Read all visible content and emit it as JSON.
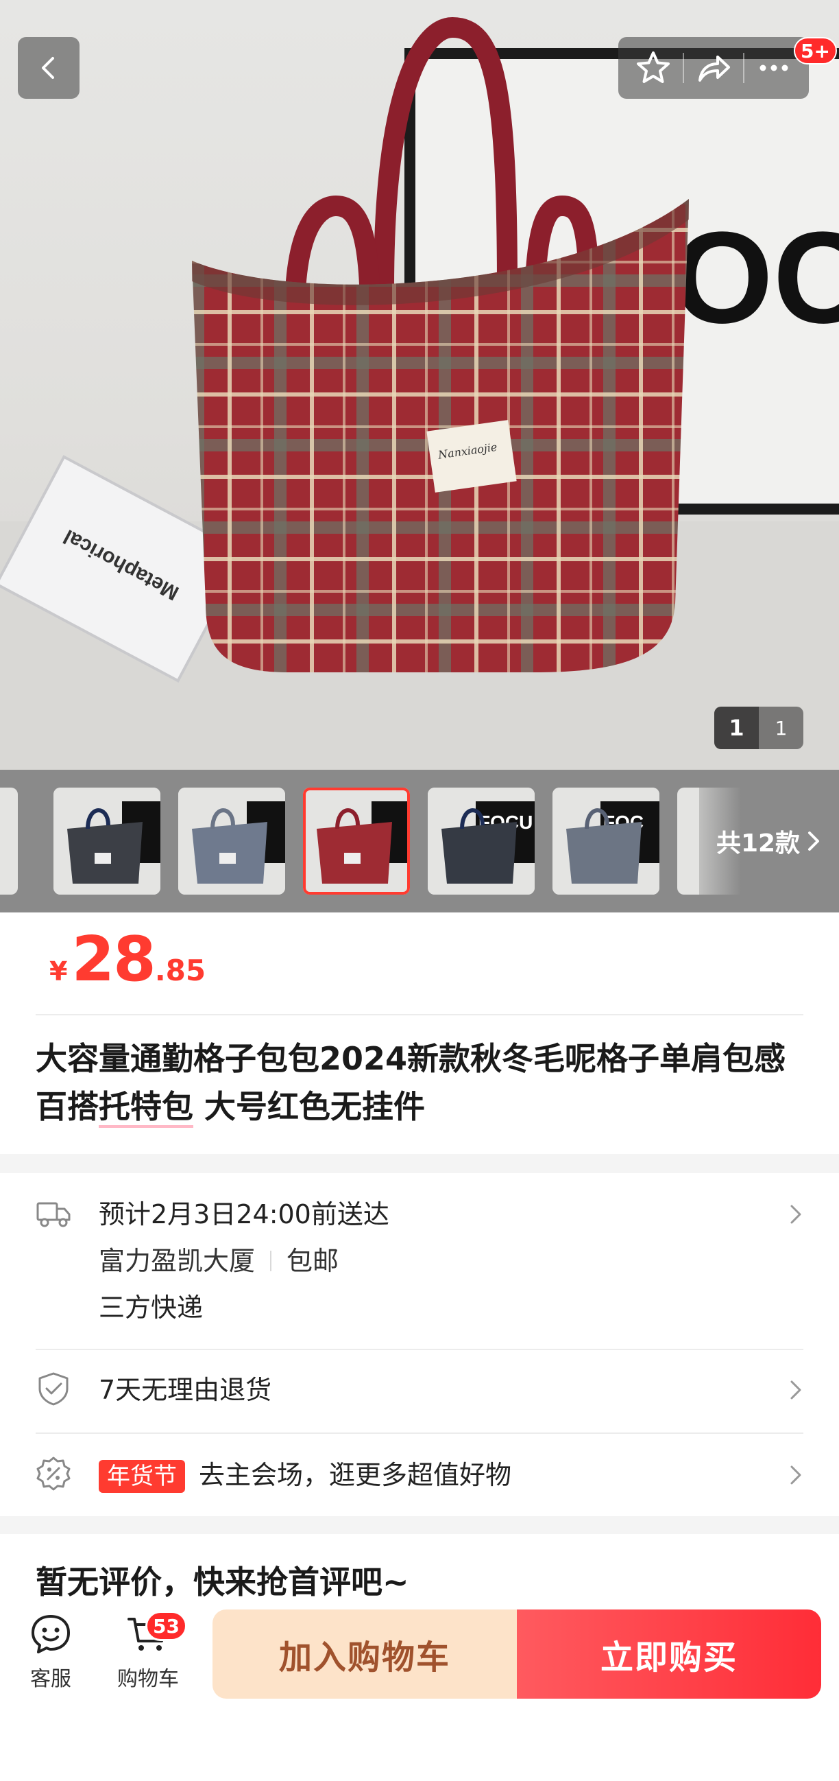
{
  "header": {
    "back_icon": "chevron-left-icon",
    "favorite_icon": "star-icon",
    "share_icon": "share-icon",
    "more_icon": "more-icon",
    "message_badge": "5+"
  },
  "gallery": {
    "current_page": "1",
    "total_pages": "1",
    "more_styles_label": "共12款",
    "thumb_count": 5,
    "active_thumb_index": 2
  },
  "product": {
    "currency": "¥",
    "price_integer": "28",
    "price_decimal": ".85",
    "title_part1": "大容量通勤格子包包2024新款秋冬毛呢格子单肩包感百搭",
    "title_underlined": "托特包",
    "title_part2": " 大号红色无挂件"
  },
  "delivery": {
    "eta": "预计2月3日24:00前送达",
    "location": "富力盈凯大厦",
    "shipping": "包邮",
    "carrier": "三方快递"
  },
  "returns": {
    "label": "7天无理由退货"
  },
  "promo": {
    "tag": "年货节",
    "text": "去主会场，逛更多超值好物"
  },
  "reviews": {
    "empty_text": "暂无评价，快来抢首评吧~"
  },
  "bottom_bar": {
    "service_label": "客服",
    "cart_label": "购物车",
    "cart_count": "53",
    "add_to_cart": "加入购物车",
    "buy_now": "立即购买"
  },
  "colors": {
    "accent_red": "#ff3b30",
    "cart_button_bg": "#fde3c9",
    "cart_button_text": "#a0522d",
    "buy_button": "#ff2d37"
  }
}
